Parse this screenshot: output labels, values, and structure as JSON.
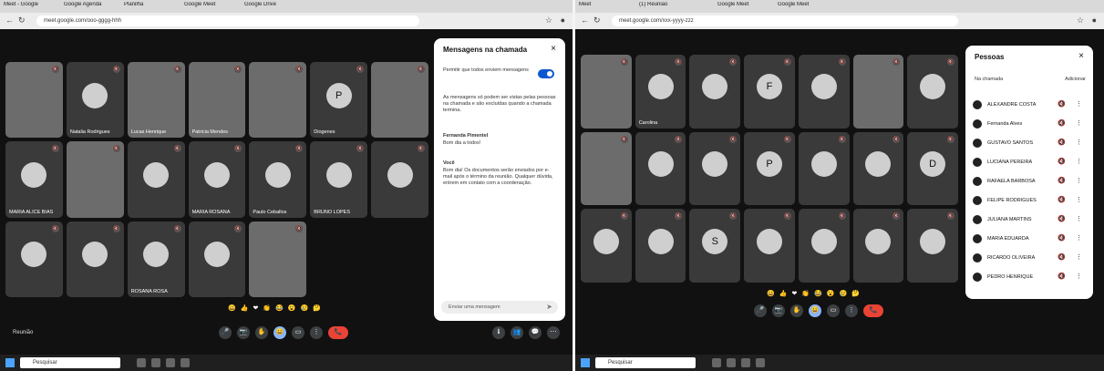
{
  "left": {
    "tabs": [
      "Meet - Google",
      "Google Agenda",
      "Planilha",
      "Google Meet",
      "Google Drive"
    ],
    "address": "meet.google.com/ooo-gggg-hhh",
    "tiles": [
      {
        "name": "",
        "initial": "",
        "video": true
      },
      {
        "name": "Natalia Rodrigues",
        "initial": "",
        "video": false
      },
      {
        "name": "Lucas Henrique",
        "initial": "",
        "video": true
      },
      {
        "name": "Patricia Mendes",
        "initial": "",
        "video": true
      },
      {
        "name": "",
        "initial": "",
        "video": true
      },
      {
        "name": "Diogenes",
        "initial": "P",
        "video": false
      },
      {
        "name": "",
        "initial": "",
        "video": true
      },
      {
        "name": "MARIA ALICE BIAS",
        "initial": "",
        "video": false
      },
      {
        "name": "",
        "initial": "",
        "video": true
      },
      {
        "name": "",
        "initial": "",
        "video": false
      },
      {
        "name": "MARIA ROSANA",
        "initial": "",
        "video": false
      },
      {
        "name": "Paulo Ceballos",
        "initial": "",
        "video": false
      },
      {
        "name": "BRUNO LOPES",
        "initial": "",
        "video": false
      },
      {
        "name": "",
        "initial": "",
        "video": false
      },
      {
        "name": "",
        "initial": "",
        "video": false
      },
      {
        "name": "",
        "initial": "",
        "video": false
      },
      {
        "name": "ROSANA ROSA",
        "initial": "",
        "video": false
      },
      {
        "name": "",
        "initial": "",
        "video": false
      },
      {
        "name": "",
        "initial": "",
        "video": true
      }
    ],
    "panel": {
      "title": "Mensagens na chamada",
      "close": "×",
      "toggle_label": "Permitir que todos enviem mensagens",
      "notice": "As mensagens só podem ser vistas pelas pessoas na chamada e são excluídas quando a chamada termina.",
      "msg1_author": "Fernanda Pimentel",
      "msg1_text": "Bom dia a todos!",
      "msg2_author": "Você",
      "msg2_text": "Bom dia! Os documentos serão enviados por e-mail após o término da reunião. Qualquer dúvida, entrem em contato com a coordenação.",
      "input_placeholder": "Enviar uma mensagem",
      "send": "➤"
    },
    "meeting_name": "Reunião",
    "reactions": [
      "😀",
      "👍",
      "❤",
      "👏",
      "😂",
      "😮",
      "😢",
      "🤔"
    ],
    "controls": [
      "🎤",
      "📷",
      "✋",
      "😀",
      "▭",
      "⋮",
      "📞"
    ],
    "side_controls": [
      "ℹ",
      "👥",
      "💬",
      "⋯"
    ],
    "taskbar": {
      "search": "Pesquisar",
      "clock": ""
    }
  },
  "right": {
    "tabs": [
      "Meet",
      "(1) Reunião",
      "Google Meet",
      "Google Meet"
    ],
    "address": "meet.google.com/xxx-yyyy-zzz",
    "tiles": [
      {
        "name": "",
        "initial": "",
        "video": true
      },
      {
        "name": "Carolina",
        "initial": "",
        "video": false
      },
      {
        "name": "",
        "initial": "",
        "video": false
      },
      {
        "name": "",
        "initial": "F",
        "video": false
      },
      {
        "name": "",
        "initial": "",
        "video": false
      },
      {
        "name": "",
        "initial": "",
        "video": true
      },
      {
        "name": "",
        "initial": "",
        "video": false
      },
      {
        "name": "",
        "initial": "",
        "video": true
      },
      {
        "name": "",
        "initial": "",
        "video": false
      },
      {
        "name": "",
        "initial": "",
        "video": false
      },
      {
        "name": "",
        "initial": "P",
        "video": false
      },
      {
        "name": "",
        "initial": "",
        "video": false
      },
      {
        "name": "",
        "initial": "",
        "video": false
      },
      {
        "name": "",
        "initial": "D",
        "video": false
      },
      {
        "name": "",
        "initial": "",
        "video": false
      },
      {
        "name": "",
        "initial": "",
        "video": false
      },
      {
        "name": "",
        "initial": "S",
        "video": false
      },
      {
        "name": "",
        "initial": "",
        "video": false
      },
      {
        "name": "",
        "initial": "",
        "video": false
      },
      {
        "name": "",
        "initial": "",
        "video": false
      },
      {
        "name": "",
        "initial": "",
        "video": false
      }
    ],
    "panel": {
      "title": "Pessoas",
      "close": "×",
      "section": "Na chamada",
      "add": "Adicionar",
      "people": [
        "ALEXANDRE COSTA",
        "Fernanda Alves",
        "GUSTAVO SANTOS",
        "LUCIANA PEREIRA",
        "RAFAELA BARBOSA",
        "FELIPE RODRIGUES",
        "JULIANA MARTINS",
        "MARIA EDUARDA",
        "RICARDO OLIVEIRA",
        "PEDRO HENRIQUE"
      ]
    },
    "meeting_name": "",
    "reactions": [
      "😀",
      "👍",
      "❤",
      "👏",
      "😂",
      "😮",
      "😢",
      "🤔"
    ],
    "controls": [
      "🎤",
      "📷",
      "✋",
      "😀",
      "▭",
      "⋮",
      "📞"
    ],
    "taskbar": {
      "search": "Pesquisar",
      "clock": ""
    }
  }
}
